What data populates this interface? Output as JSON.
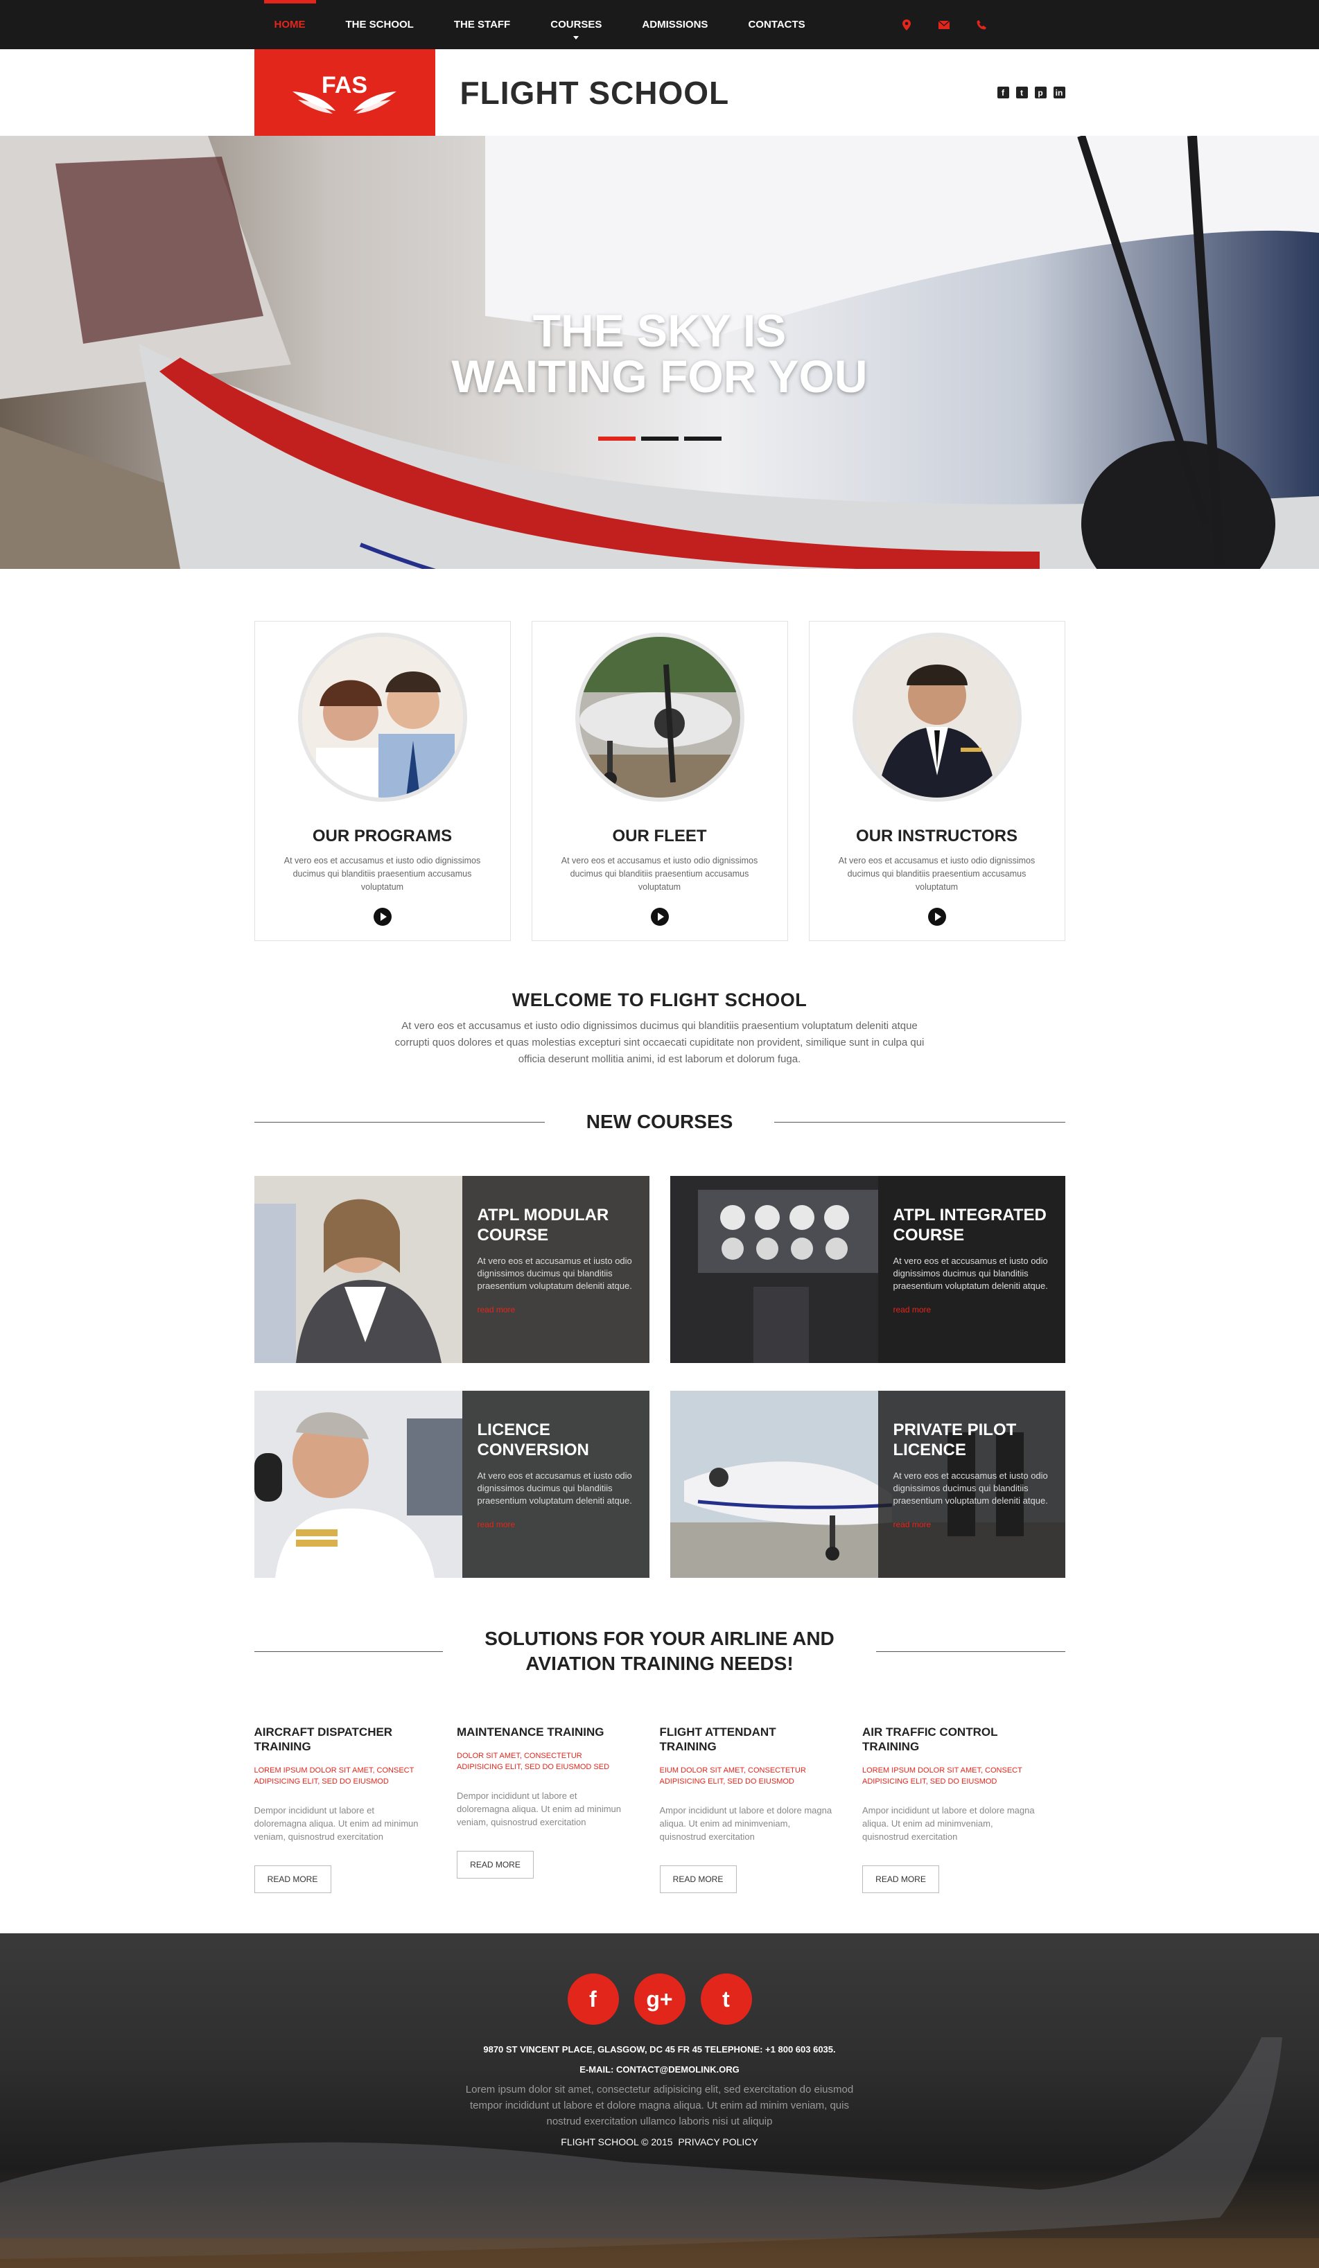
{
  "nav": {
    "items": [
      {
        "label": "HOME"
      },
      {
        "label": "THE SCHOOL"
      },
      {
        "label": "THE STAFF"
      },
      {
        "label": "COURSES"
      },
      {
        "label": "ADMISSIONS"
      },
      {
        "label": "CONTACTS"
      }
    ],
    "contact_icons": [
      "map-pin-icon",
      "envelope-icon",
      "phone-icon"
    ]
  },
  "header": {
    "logo_text": "FAS",
    "title": "FLIGHT SCHOOL",
    "socials": [
      {
        "icon": "facebook-icon",
        "glyph": "f"
      },
      {
        "icon": "tumblr-icon",
        "glyph": "t"
      },
      {
        "icon": "pinterest-icon",
        "glyph": "p"
      },
      {
        "icon": "linkedin-icon",
        "glyph": "in"
      }
    ]
  },
  "hero": {
    "title_line1": "THE SKY IS",
    "title_line2": "WAITING FOR YOU",
    "slides_count": 3,
    "active_slide": 1
  },
  "features": [
    {
      "title": "OUR PROGRAMS",
      "text": "At vero eos et accusamus et iusto odio dignissimos ducimus qui blanditiis praesentium accusamus voluptatum"
    },
    {
      "title": "OUR FLEET",
      "text": "At vero eos et accusamus et iusto odio dignissimos ducimus qui blanditiis praesentium accusamus voluptatum"
    },
    {
      "title": "OUR INSTRUCTORS",
      "text": "At vero eos et accusamus et iusto odio dignissimos ducimus qui blanditiis praesentium accusamus voluptatum"
    }
  ],
  "welcome": {
    "title": "WELCOME TO FLIGHT SCHOOL",
    "text": "At vero eos et accusamus et iusto odio dignissimos ducimus qui blanditiis praesentium voluptatum deleniti atque corrupti quos dolores et quas molestias excepturi sint occaecati cupiditate non provident, similique sunt in culpa qui officia deserunt mollitia animi, id est laborum et dolorum fuga."
  },
  "new_courses": {
    "title": "NEW COURSES",
    "items": [
      {
        "title": "ATPL MODULAR COURSE",
        "text": "At vero eos et accusamus et iusto odio dignissimos ducimus qui blanditiis praesentium voluptatum deleniti atque.",
        "more": "read more"
      },
      {
        "title": "ATPL INTEGRATED COURSE",
        "text": "At vero eos et accusamus et iusto odio dignissimos ducimus qui blanditiis praesentium voluptatum deleniti atque.",
        "more": "read more"
      },
      {
        "title": "LICENCE CONVERSION",
        "text": "At vero eos et accusamus et iusto odio dignissimos ducimus qui blanditiis praesentium voluptatum deleniti atque.",
        "more": "read more"
      },
      {
        "title": "PRIVATE PILOT LICENCE",
        "text": "At vero eos et accusamus et iusto odio dignissimos ducimus qui blanditiis praesentium voluptatum deleniti atque.",
        "more": "read more"
      }
    ]
  },
  "solutions": {
    "title_line1": "SOLUTIONS FOR YOUR AIRLINE AND",
    "title_line2": "AVIATION TRAINING NEEDS!",
    "items": [
      {
        "title": "AIRCRAFT DISPATCHER TRAINING",
        "red": "LOREM IPSUM DOLOR SIT AMET, CONSECT ADIPISICING ELIT, SED DO EIUSMOD",
        "grey": "Dempor incididunt ut labore et doloremagna aliqua. Ut enim ad minimun veniam, quisnostrud exercitation",
        "button": "READ MORE"
      },
      {
        "title": "MAINTENANCE TRAINING",
        "red": "DOLOR SIT AMET, CONSECTETUR ADIPISICING ELIT, SED DO EIUSMOD SED",
        "grey": "Dempor incididunt ut labore et doloremagna aliqua. Ut enim ad minimun veniam, quisnostrud exercitation",
        "button": "READ MORE"
      },
      {
        "title": "FLIGHT ATTENDANT TRAINING",
        "red": "EIUM DOLOR SIT AMET, CONSECTETUR ADIPISICING ELIT, SED DO EIUSMOD",
        "grey": "Ampor incididunt ut labore et dolore magna aliqua. Ut enim ad minimveniam, quisnostrud exercitation",
        "button": "READ MORE"
      },
      {
        "title": "AIR TRAFFIC CONTROL TRAINING",
        "red": "LOREM IPSUM DOLOR SIT AMET, CONSECT ADIPISICING ELIT, SED DO EIUSMOD",
        "grey": "Ampor incididunt ut labore et dolore magna aliqua. Ut enim ad minimveniam, quisnostrud exercitation",
        "button": "READ MORE"
      }
    ]
  },
  "footer": {
    "socials": [
      {
        "icon": "facebook-icon",
        "glyph": "f"
      },
      {
        "icon": "google-plus-icon",
        "glyph": "g+"
      },
      {
        "icon": "tumblr-icon",
        "glyph": "t"
      }
    ],
    "address": "9870 ST VINCENT PLACE, GLASGOW, DC 45 FR 45 TELEPHONE: +1 800 603 6035.",
    "email": "E-MAIL: CONTACT@DEMOLINK.ORG",
    "lorem": "Lorem ipsum dolor sit amet, consectetur adipisicing elit, sed exercitation do eiusmod tempor incididunt ut labore et dolore magna aliqua. Ut enim ad minim veniam, quis nostrud exercitation ullamco laboris nisi ut aliquip",
    "copyright": "FLIGHT SCHOOL © 2015",
    "privacy": "PRIVACY POLICY"
  },
  "colors": {
    "accent": "#e3261c",
    "nav_bg": "#1a1a1a",
    "text_dark": "#222222"
  }
}
